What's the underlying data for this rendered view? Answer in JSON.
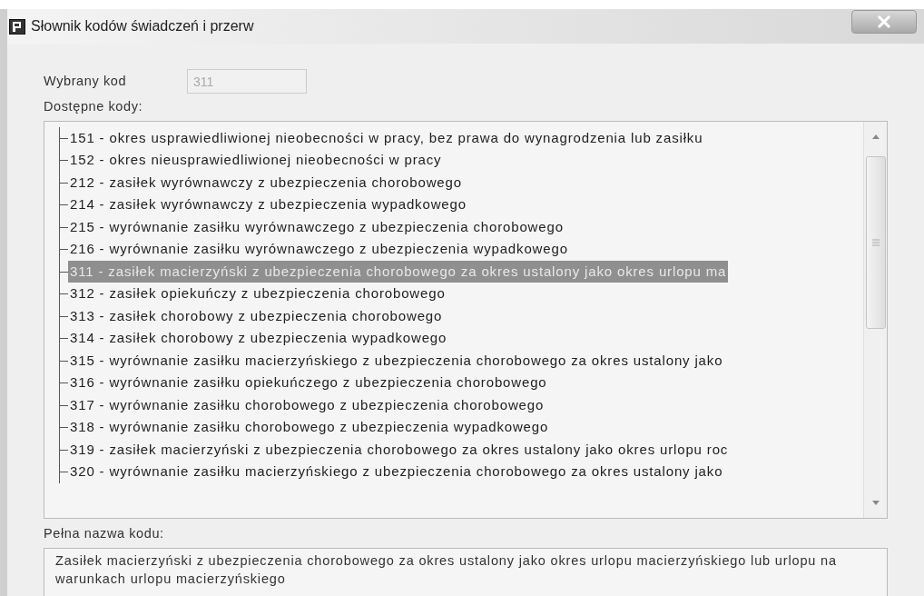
{
  "window": {
    "title": "Słownik kodów świadczeń i przerw"
  },
  "selected_code": {
    "label": "Wybrany kod",
    "value": "311",
    "disabled": true
  },
  "codes_list": {
    "label": "Dostępne kody:",
    "items": [
      {
        "text": "151 - okres usprawiedliwionej nieobecności w pracy, bez prawa do wynagrodzenia lub zasiłku",
        "selected": false
      },
      {
        "text": "152 - okres nieusprawiedliwionej nieobecności w pracy",
        "selected": false
      },
      {
        "text": "212 - zasiłek wyrównawczy z ubezpieczenia chorobowego",
        "selected": false
      },
      {
        "text": "214 - zasiłek wyrównawczy z ubezpieczenia wypadkowego",
        "selected": false
      },
      {
        "text": "215 - wyrównanie zasiłku wyrównawczego z ubezpieczenia chorobowego",
        "selected": false
      },
      {
        "text": "216 - wyrównanie zasiłku wyrównawczego z ubezpieczenia wypadkowego",
        "selected": false
      },
      {
        "text": "311 - zasiłek macierzyński z ubezpieczenia chorobowego za okres ustalony jako okres urlopu ma",
        "selected": true
      },
      {
        "text": "312 - zasiłek opiekuńczy z ubezpieczenia chorobowego",
        "selected": false
      },
      {
        "text": "313 - zasiłek chorobowy z ubezpieczenia chorobowego",
        "selected": false
      },
      {
        "text": "314 - zasiłek chorobowy z ubezpieczenia wypadkowego",
        "selected": false
      },
      {
        "text": "315 - wyrównanie zasiłku macierzyńskiego z ubezpieczenia chorobowego za okres ustalony jako",
        "selected": false
      },
      {
        "text": "316 - wyrównanie zasiłku opiekuńczego z ubezpieczenia chorobowego",
        "selected": false
      },
      {
        "text": "317 - wyrównanie zasiłku chorobowego z ubezpieczenia chorobowego",
        "selected": false
      },
      {
        "text": "318 - wyrównanie zasiłku chorobowego z ubezpieczenia wypadkowego",
        "selected": false
      },
      {
        "text": "319 - zasiłek macierzyński z ubezpieczenia chorobowego za okres ustalony jako okres urlopu roc",
        "selected": false
      },
      {
        "text": "320 - wyrównanie zasiłku macierzyńskiego z ubezpieczenia chorobowego za okres ustalony jako",
        "selected": false
      }
    ]
  },
  "full_name": {
    "label": "Pełna nazwa kodu:",
    "value": "Zasiłek macierzyński z ubezpieczenia chorobowego za okres ustalony jako okres urlopu macierzyńskiego lub urlopu na warunkach urlopu macierzyńskiego"
  }
}
